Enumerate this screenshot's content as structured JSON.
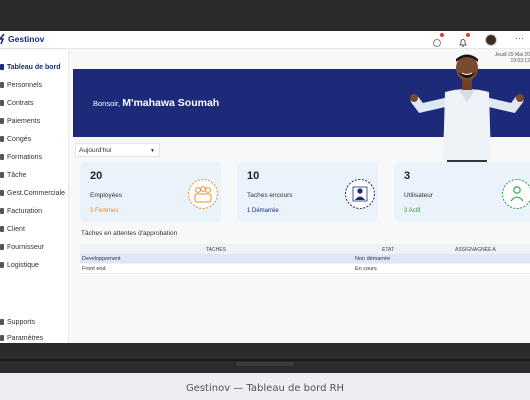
{
  "app": {
    "name": "Gestinov"
  },
  "header": {
    "date_line1": "Jeudi 29 Mai 20",
    "date_line2": "19:03:12",
    "more": "⋯"
  },
  "sidebar": {
    "items": [
      {
        "label": "Tableau de bord",
        "active": true
      },
      {
        "label": "Personnels"
      },
      {
        "label": "Contrats"
      },
      {
        "label": "Paiements"
      },
      {
        "label": "Congés"
      },
      {
        "label": "Formations"
      },
      {
        "label": "Tâche"
      },
      {
        "label": "Gest.Commerciale"
      },
      {
        "label": "Facturation"
      },
      {
        "label": "Client"
      },
      {
        "label": "Fournisseur"
      },
      {
        "label": "Logistique"
      }
    ],
    "bottom": [
      {
        "label": "Supports"
      },
      {
        "label": "Paramètres"
      }
    ]
  },
  "banner": {
    "greeting": "Bonsoir,",
    "name": "M'mahawa Soumah"
  },
  "filter": {
    "value": "Aujourd'hui"
  },
  "cards": [
    {
      "number": "20",
      "label": "Employées",
      "sub": "3 Femmes",
      "sub_color": "#e3902c",
      "icon": "group-icon",
      "icon_color": "#e3902c"
    },
    {
      "number": "10",
      "label": "Taches encours",
      "sub": "1 Démarrée",
      "sub_color": "#1d2a7a",
      "icon": "task-person-icon",
      "icon_color": "#1d2a7a"
    },
    {
      "number": "3",
      "label": "Utilisateur",
      "sub": "3 Actif",
      "sub_color": "#2e9e3f",
      "icon": "user-icon",
      "icon_color": "#2e9e3f"
    }
  ],
  "approvals": {
    "title": "Tâches en attentes d'approbation",
    "columns": [
      "TACHES",
      "ETAT",
      "ASSIGNAGNEE A"
    ],
    "rows": [
      {
        "task": "Developpement",
        "state": "Non démarrée",
        "assignee": ""
      },
      {
        "task": "Front end",
        "state": "En cours",
        "assignee": ""
      }
    ]
  },
  "caption": "Gestinov — Tableau de bord RH",
  "colors": {
    "brand": "#1d2a7a",
    "bezel": "#2b2b2b",
    "card_bg": "#eaf2fb"
  }
}
